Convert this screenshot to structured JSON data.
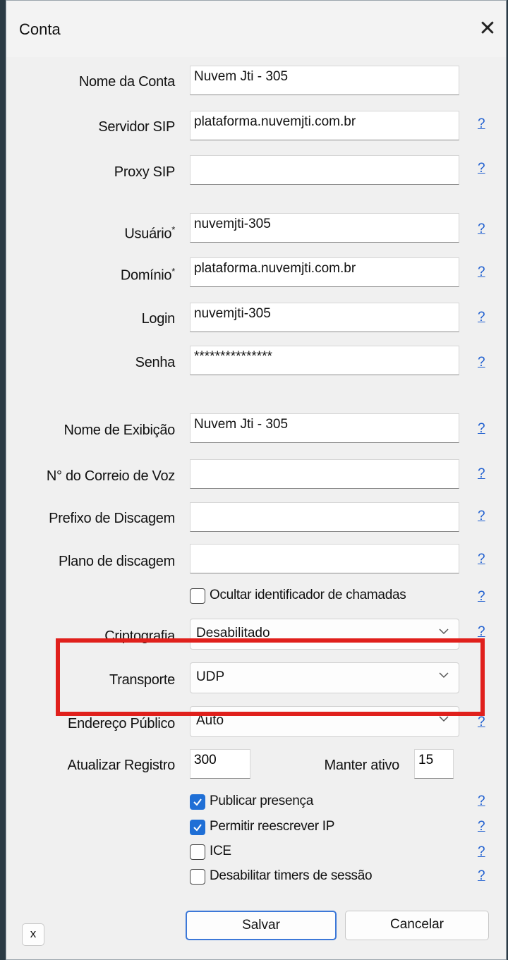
{
  "window": {
    "title": "Conta",
    "close_glyph": "✕"
  },
  "help_glyph": "?",
  "fields": {
    "nome_conta": {
      "label": "Nome da Conta",
      "value": "Nuvem Jti - 305"
    },
    "servidor_sip": {
      "label": "Servidor SIP",
      "value": "plataforma.nuvemjti.com.br"
    },
    "proxy_sip": {
      "label": "Proxy SIP",
      "value": ""
    },
    "usuario": {
      "label": "Usuário",
      "value": "nuvemjti-305"
    },
    "dominio": {
      "label": "Domínio",
      "value": "plataforma.nuvemjti.com.br"
    },
    "login": {
      "label": "Login",
      "value": "nuvemjti-305"
    },
    "senha": {
      "label": "Senha",
      "value": "***************"
    },
    "nome_exibicao": {
      "label": "Nome de Exibição",
      "value": "Nuvem Jti - 305"
    },
    "correio_voz": {
      "label": "N° do Correio de Voz",
      "value": ""
    },
    "prefixo": {
      "label": "Prefixo de Discagem",
      "value": ""
    },
    "plano": {
      "label": "Plano de discagem",
      "value": ""
    }
  },
  "required_marker": "*",
  "ocultar_id": {
    "label": "Ocultar identificador de chamadas",
    "checked": false
  },
  "criptografia": {
    "label": "Criptografia",
    "value": "Desabilitado"
  },
  "transporte": {
    "label": "Transporte",
    "value": "UDP"
  },
  "endereco_publico": {
    "label": "Endereço Público",
    "value": "Auto"
  },
  "atualizar_registro": {
    "label": "Atualizar Registro",
    "value": "300"
  },
  "manter_ativo": {
    "label": "Manter ativo",
    "value": "15"
  },
  "options": [
    {
      "label": "Publicar presença",
      "checked": true
    },
    {
      "label": "Permitir reescrever IP",
      "checked": true
    },
    {
      "label": "ICE",
      "checked": false
    },
    {
      "label": "Desabilitar timers de sessão",
      "checked": false
    }
  ],
  "buttons": {
    "x": "x",
    "salvar": "Salvar",
    "cancelar": "Cancelar"
  },
  "colors": {
    "accent": "#1f6fd6",
    "highlight_box": "#e0201c",
    "link": "#1f5fd0"
  }
}
